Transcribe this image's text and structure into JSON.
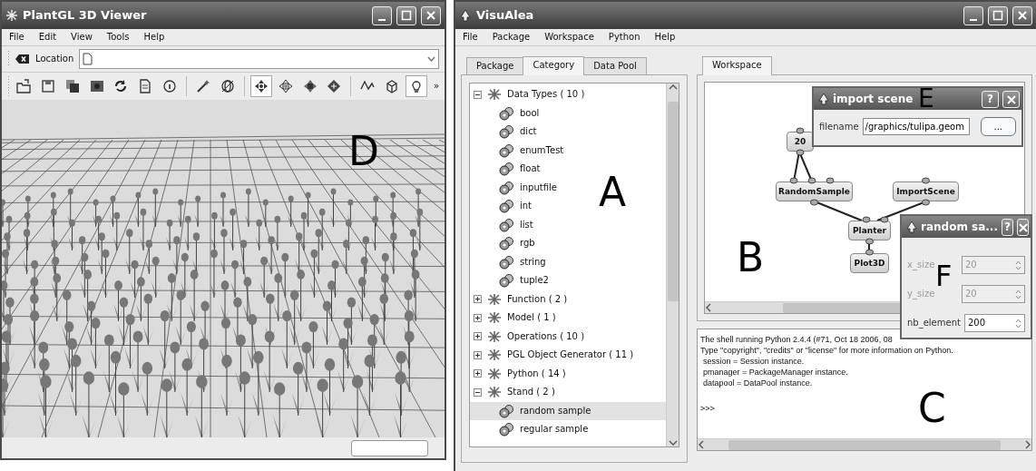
{
  "viewer": {
    "title": "PlantGL 3D Viewer",
    "menu": [
      "File",
      "Edit",
      "View",
      "Tools",
      "Help"
    ],
    "location_label": "Location",
    "toolbar": [
      {
        "selected": false
      },
      {
        "selected": false
      },
      {
        "selected": false
      },
      {
        "selected": false
      },
      {
        "selected": false
      },
      {
        "selected": false
      },
      {
        "selected": false
      },
      {
        "selected": false
      },
      {
        "selected": false
      },
      {
        "selected": true
      },
      {
        "selected": false
      },
      {
        "selected": false
      },
      {
        "selected": false
      },
      {
        "selected": false
      },
      {
        "selected": false
      },
      {
        "selected": true
      }
    ],
    "toolbar_overflow": "»"
  },
  "visualea": {
    "title": "VisuAlea",
    "menu": [
      "File",
      "Package",
      "Workspace",
      "Python",
      "Help"
    ],
    "left_tabs": [
      {
        "label": "Package",
        "selected": false
      },
      {
        "label": "Category",
        "selected": true
      },
      {
        "label": "Data Pool",
        "selected": false
      }
    ],
    "tree": [
      {
        "label": "Data Types ( 10 )",
        "expanded": true,
        "selected": false,
        "children": [
          {
            "label": "bool",
            "selected": false
          },
          {
            "label": "dict",
            "selected": false
          },
          {
            "label": "enumTest",
            "selected": false
          },
          {
            "label": "float",
            "selected": false
          },
          {
            "label": "inputfile",
            "selected": false
          },
          {
            "label": "int",
            "selected": false
          },
          {
            "label": "list",
            "selected": false
          },
          {
            "label": "rgb",
            "selected": false
          },
          {
            "label": "string",
            "selected": false
          },
          {
            "label": "tuple2",
            "selected": false
          }
        ]
      },
      {
        "label": "Function ( 2 )",
        "expanded": false,
        "selected": false
      },
      {
        "label": "Model ( 1 )",
        "expanded": false,
        "selected": false
      },
      {
        "label": "Operations ( 10 )",
        "expanded": false,
        "selected": false
      },
      {
        "label": "PGL Object Generator ( 11 )",
        "expanded": false,
        "selected": false
      },
      {
        "label": "Python ( 14 )",
        "expanded": false,
        "selected": false
      },
      {
        "label": "Stand ( 2 )",
        "expanded": true,
        "selected": false,
        "children": [
          {
            "label": "random sample",
            "selected": true
          },
          {
            "label": "regular sample",
            "selected": false
          }
        ]
      }
    ],
    "workspace_tabs": [
      {
        "label": "Workspace",
        "selected": true
      }
    ],
    "graph": {
      "nodes": [
        {
          "label": "20"
        },
        {
          "label": "RandomSample"
        },
        {
          "label": "ImportScene"
        },
        {
          "label": "Planter"
        },
        {
          "label": "Plot3D"
        }
      ]
    },
    "shell": {
      "lines": [
        "The shell running Python 2.4.4 (#71, Oct 18 2006, 08",
        "Type \"copyright\", \"credits\" or \"license\" for more information on Python.",
        "session = Session instance.",
        "pmanager = PackageManager instance.",
        "datapool = DataPool instance."
      ],
      "prompt": ">>>"
    },
    "dialogs": [
      {
        "title": "import scene",
        "help": "?",
        "fields": [
          {
            "kind": "text",
            "label": "filename",
            "value": "/graphics/tulipa.geom",
            "disabled": false
          }
        ],
        "button": "..."
      },
      {
        "title": "random sa...",
        "help": "?",
        "fields": [
          {
            "kind": "spin",
            "label": "x_size",
            "value": "20",
            "disabled": true
          },
          {
            "kind": "spin",
            "label": "y_size",
            "value": "20",
            "disabled": true
          },
          {
            "kind": "spin",
            "label": "nb_element",
            "value": "200",
            "disabled": false
          }
        ]
      }
    ]
  },
  "figure_labels": [
    "A",
    "B",
    "C",
    "D",
    "E",
    "F"
  ]
}
